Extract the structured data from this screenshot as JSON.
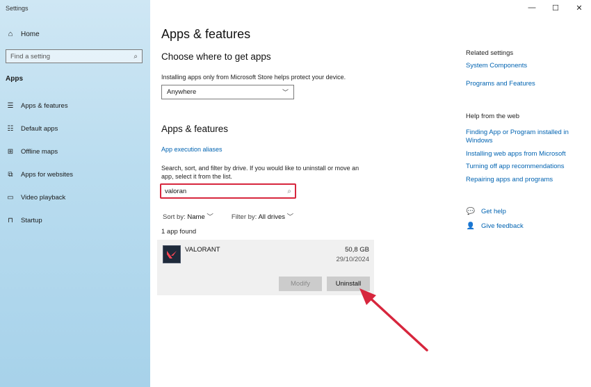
{
  "window": {
    "title": "Settings",
    "minimize": "—",
    "maximize": "☐",
    "close": "✕"
  },
  "sidebar": {
    "home": "Home",
    "search_placeholder": "Find a setting",
    "section": "Apps",
    "items": [
      {
        "label": "Apps & features",
        "icon": "list-icon"
      },
      {
        "label": "Default apps",
        "icon": "default-apps-icon"
      },
      {
        "label": "Offline maps",
        "icon": "map-icon"
      },
      {
        "label": "Apps for websites",
        "icon": "website-icon"
      },
      {
        "label": "Video playback",
        "icon": "video-icon"
      },
      {
        "label": "Startup",
        "icon": "startup-icon"
      }
    ]
  },
  "main": {
    "title": "Apps & features",
    "where_heading": "Choose where to get apps",
    "where_desc": "Installing apps only from Microsoft Store helps protect your device.",
    "where_value": "Anywhere",
    "apps_heading": "Apps & features",
    "aliases_link": "App execution aliases",
    "search_desc_1": "Search, sort, and filter by drive. If you would like to uninstall or move an",
    "search_desc_2": "app, select it from the list.",
    "search_value": "valoran",
    "sort_label": "Sort by:",
    "sort_value": "Name",
    "filter_label": "Filter by:",
    "filter_value": "All drives",
    "found": "1 app found",
    "app": {
      "name": "VALORANT",
      "size": "50,8 GB",
      "date": "29/10/2024",
      "modify": "Modify",
      "uninstall": "Uninstall"
    }
  },
  "right": {
    "related_heading": "Related settings",
    "related_links": [
      "System Components",
      "Programs and Features"
    ],
    "web_heading": "Help from the web",
    "web_links": [
      "Finding App or Program installed in Windows",
      "Installing web apps from Microsoft",
      "Turning off app recommendations",
      "Repairing apps and programs"
    ],
    "get_help": "Get help",
    "feedback": "Give feedback"
  },
  "colors": {
    "accent": "#0063b1",
    "highlight": "#d7263d"
  }
}
